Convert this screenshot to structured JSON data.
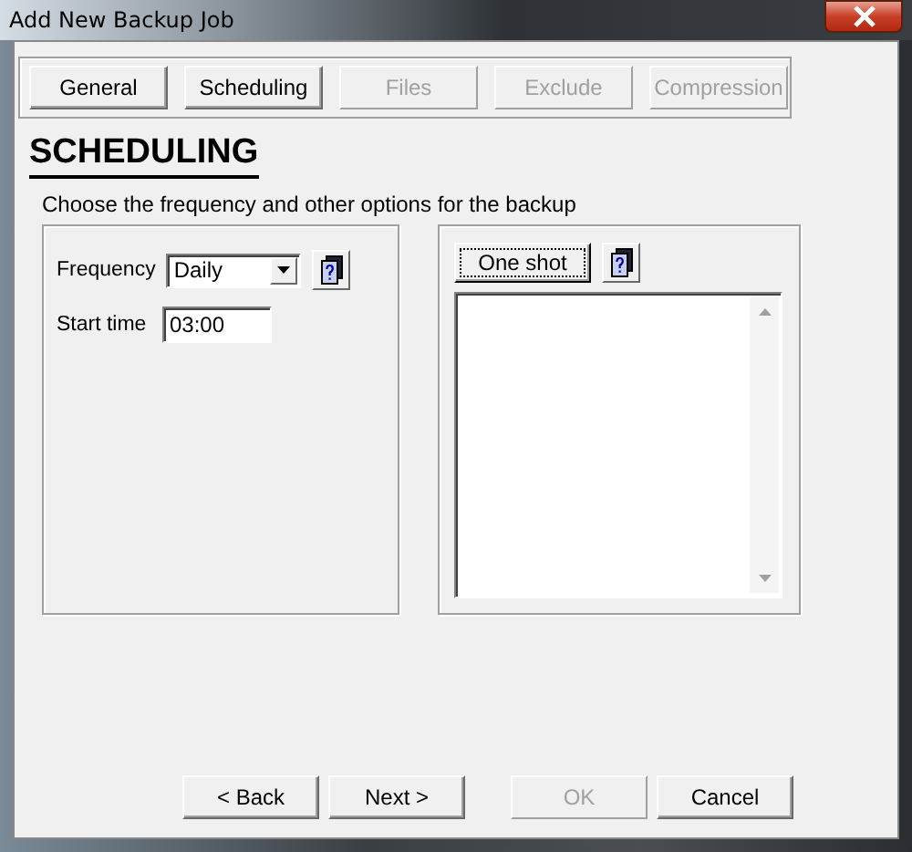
{
  "window": {
    "title": "Add New Backup Job"
  },
  "nav_buttons": [
    {
      "label": "General",
      "disabled": false
    },
    {
      "label": "Scheduling",
      "disabled": false
    },
    {
      "label": "Files",
      "disabled": true
    },
    {
      "label": "Exclude",
      "disabled": true
    },
    {
      "label": "Compression",
      "disabled": true
    }
  ],
  "heading": "SCHEDULING",
  "description": "Choose the frequency and other options for the backup",
  "frequency": {
    "label": "Frequency",
    "value": "Daily"
  },
  "start_time": {
    "label": "Start time",
    "value": "03:00"
  },
  "one_shot_button": "One shot",
  "footer_buttons": [
    {
      "label": "< Back",
      "disabled": false
    },
    {
      "label": "Next >",
      "disabled": false
    },
    {
      "label": "OK",
      "disabled": true
    },
    {
      "label": "Cancel",
      "disabled": false
    }
  ]
}
